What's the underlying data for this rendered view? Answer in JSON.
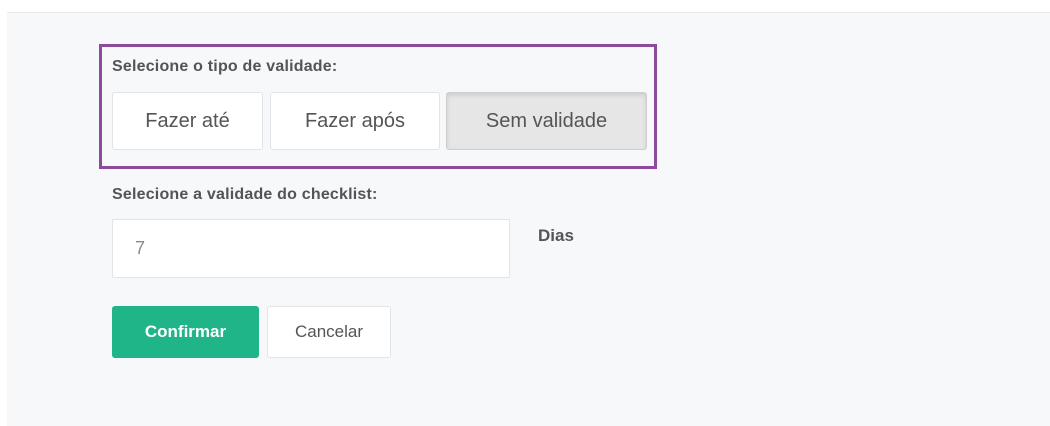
{
  "validity_type": {
    "label": "Selecione o tipo de validade:",
    "options": [
      "Fazer até",
      "Fazer após",
      "Sem validade"
    ],
    "selected": "Sem validade"
  },
  "checklist_validity": {
    "label": "Selecione a validade do checklist:",
    "value": "7",
    "unit": "Dias"
  },
  "actions": {
    "confirm_label": "Confirmar",
    "cancel_label": "Cancelar"
  },
  "colors": {
    "highlight_frame": "#8e4a9c",
    "confirm_button": "#1fb589",
    "background": "#f7f8fa"
  }
}
